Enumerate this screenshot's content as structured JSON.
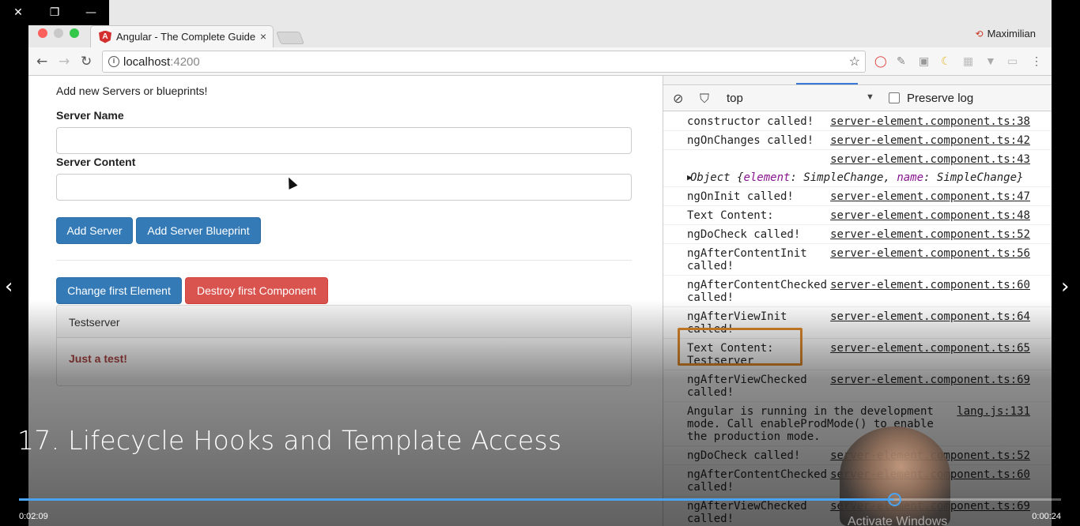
{
  "player": {
    "close_glyph": "✕",
    "restore_glyph": "❐",
    "minimize_glyph": "—",
    "video_title": "17. Lifecycle Hooks and Template Access",
    "time_elapsed": "0:02:09",
    "time_remaining": "0:00:24",
    "progress_percent": 84,
    "prev_glyph": "‹",
    "next_glyph": "›",
    "watermark": "Activate Windows"
  },
  "browser": {
    "tab_title": "Angular - The Complete Guide",
    "tab_icon_letter": "A",
    "tab_close": "×",
    "profile_name": "Maximilian",
    "url_host": "localhost",
    "url_port": ":4200",
    "back_glyph": "←",
    "forward_glyph": "→",
    "reload_glyph": "↻",
    "star_glyph": "☆"
  },
  "page": {
    "heading": "Add new Servers or blueprints!",
    "server_name_label": "Server Name",
    "server_content_label": "Server Content",
    "server_name_value": "",
    "server_content_value": "",
    "add_server": "Add Server",
    "add_blueprint": "Add Server Blueprint",
    "change_first": "Change first Element",
    "destroy_first": "Destroy first Component",
    "element_name": "Testserver",
    "element_content": "Just a test!"
  },
  "devtools": {
    "context": "top",
    "preserve_log": "Preserve log",
    "log": [
      {
        "msg": "constructor called!",
        "src": "server-element.component.ts:38"
      },
      {
        "msg": "ngOnChanges called!",
        "src": "server-element.component.ts:42"
      },
      {
        "msg": "",
        "src": "server-element.component.ts:43"
      },
      {
        "obj_prefix": "Object {",
        "k1": "element",
        "v1": ": SimpleChange, ",
        "k2": "name",
        "v2": ": SimpleChange}"
      },
      {
        "msg": "ngOnInit called!",
        "src": "server-element.component.ts:47"
      },
      {
        "msg": "Text Content:",
        "src": "server-element.component.ts:48"
      },
      {
        "msg": "ngDoCheck called!",
        "src": "server-element.component.ts:52"
      },
      {
        "msg": "ngAfterContentInit called!",
        "src": "server-element.component.ts:56"
      },
      {
        "msg": "ngAfterContentChecked called!",
        "src": "server-element.component.ts:60"
      },
      {
        "msg": "ngAfterViewInit called!",
        "src": "server-element.component.ts:64"
      },
      {
        "msg": "Text Content: Testserver",
        "src": "server-element.component.ts:65"
      },
      {
        "msg": "ngAfterViewChecked called!",
        "src": "server-element.component.ts:69"
      },
      {
        "msg": "Angular is running in the development mode. Call enableProdMode() to enable the production mode.",
        "src": "lang.js:131"
      },
      {
        "msg": "ngDoCheck called!",
        "src": "server-element.component.ts:52"
      },
      {
        "msg": "ngAfterContentChecked called!",
        "src": "server-element.component.ts:60"
      },
      {
        "msg": "ngAfterViewChecked called!",
        "src": "server-element.component.ts:69"
      }
    ]
  },
  "colors": {
    "primary": "#337ab7",
    "danger": "#d9534f",
    "highlight": "#e08a2c",
    "progress": "#4aa3f0"
  }
}
